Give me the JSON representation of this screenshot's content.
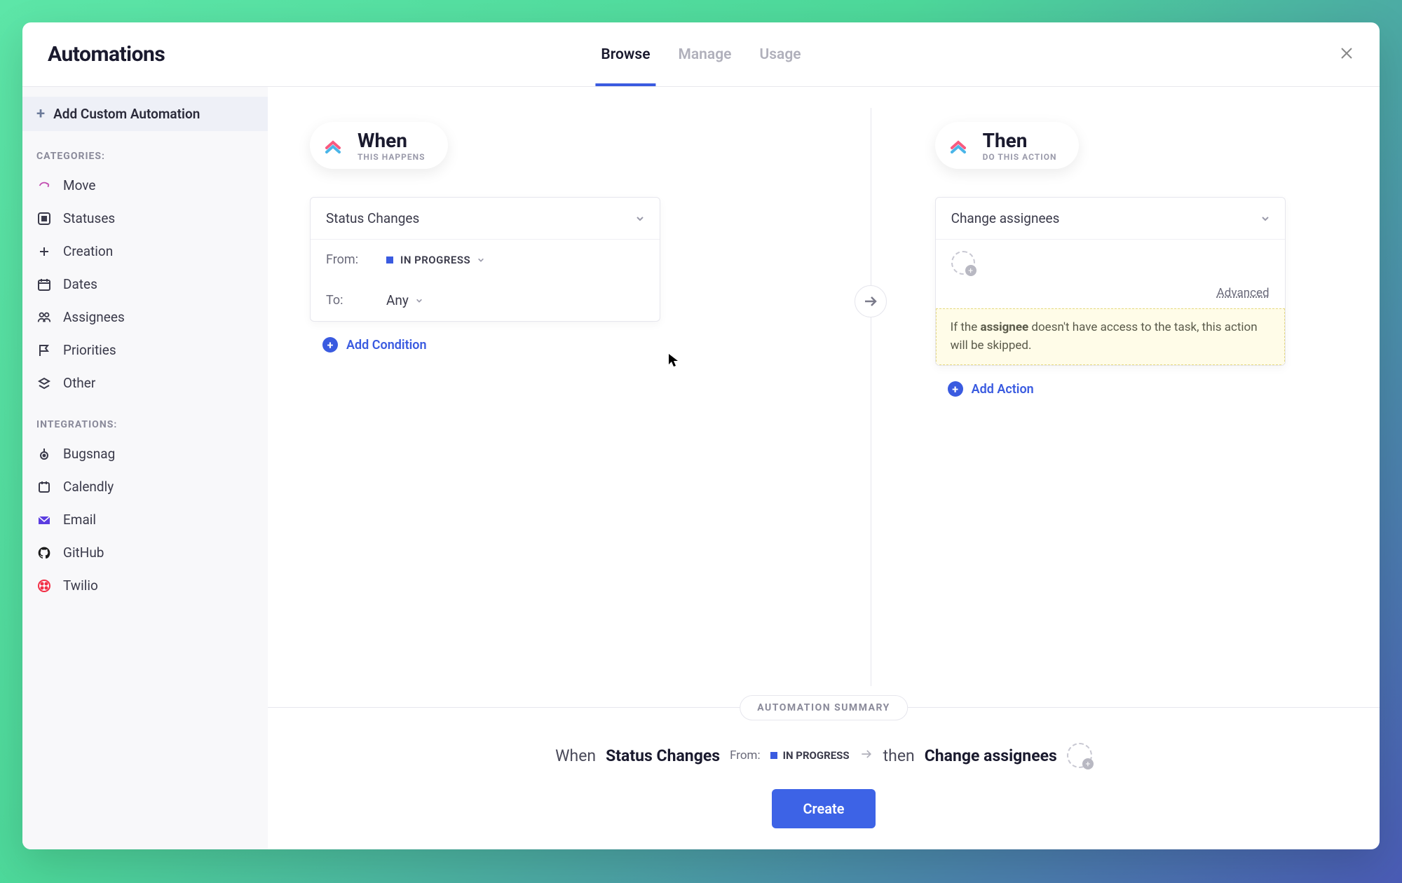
{
  "header": {
    "title": "Automations",
    "tabs": [
      {
        "label": "Browse",
        "active": true
      },
      {
        "label": "Manage",
        "active": false
      },
      {
        "label": "Usage",
        "active": false
      }
    ]
  },
  "sidebar": {
    "add_label": "Add Custom Automation",
    "categories_title": "CATEGORIES:",
    "categories": [
      {
        "label": "Move",
        "icon": "move"
      },
      {
        "label": "Statuses",
        "icon": "status"
      },
      {
        "label": "Creation",
        "icon": "plus-square"
      },
      {
        "label": "Dates",
        "icon": "calendar"
      },
      {
        "label": "Assignees",
        "icon": "people"
      },
      {
        "label": "Priorities",
        "icon": "flag"
      },
      {
        "label": "Other",
        "icon": "layers"
      }
    ],
    "integrations_title": "INTEGRATIONS:",
    "integrations": [
      {
        "label": "Bugsnag",
        "icon": "bugsnag"
      },
      {
        "label": "Calendly",
        "icon": "calendly"
      },
      {
        "label": "Email",
        "icon": "email"
      },
      {
        "label": "GitHub",
        "icon": "github"
      },
      {
        "label": "Twilio",
        "icon": "twilio"
      }
    ]
  },
  "builder": {
    "when": {
      "title": "When",
      "subtitle": "THIS HAPPENS",
      "trigger": "Status Changes",
      "from_label": "From:",
      "from_status": "IN PROGRESS",
      "to_label": "To:",
      "to_value": "Any",
      "add_condition": "Add Condition"
    },
    "then": {
      "title": "Then",
      "subtitle": "DO THIS ACTION",
      "action": "Change assignees",
      "advanced": "Advanced",
      "warning_prefix": "If the ",
      "warning_bold": "assignee",
      "warning_suffix": " doesn't have access to the task, this action will be skipped.",
      "add_action": "Add Action"
    }
  },
  "summary": {
    "badge": "AUTOMATION SUMMARY",
    "when_word": "When",
    "trigger": "Status Changes",
    "from_label": "From:",
    "from_status": "IN PROGRESS",
    "then_word": "then",
    "action": "Change assignees",
    "create": "Create"
  },
  "colors": {
    "accent": "#3a5be0",
    "status_blue": "#3a5be0",
    "github_black": "#1a1a1a",
    "twilio_red": "#f22f46",
    "email_purple": "#5b3de0"
  }
}
